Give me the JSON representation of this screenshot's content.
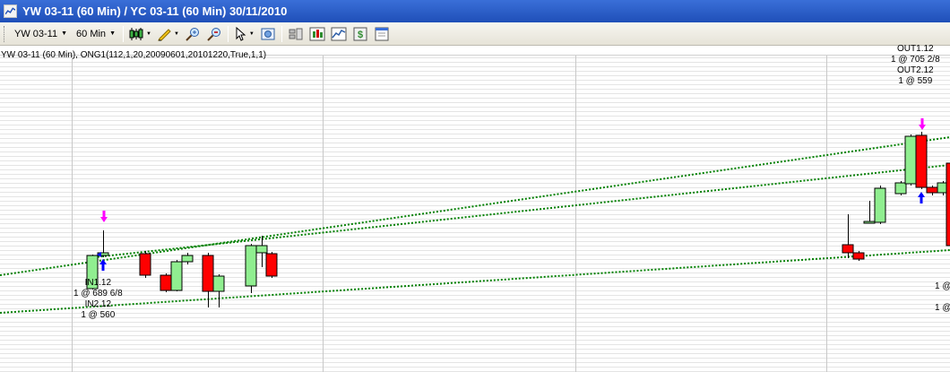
{
  "window": {
    "title": "YW 03-11 (60 Min) / YC 03-11 (60 Min)  30/11/2010"
  },
  "toolbar": {
    "symbol_value": "YW 03-11",
    "interval_value": "60 Min",
    "buttons": [
      "bar-type-icon",
      "drawing-pencil-icon",
      "zoom-in-icon",
      "zoom-out-icon",
      "cursor-select-icon",
      "chart-properties-icon",
      "data-box-icon",
      "indicators-icon",
      "chart-style-icon",
      "strategies-icon",
      "window-template-icon"
    ]
  },
  "chart": {
    "study_label": "YW 03-11 (60 Min), ONG1(112,1,20,20090601,20101220,True,1,1)",
    "entry_labels": [
      "IN1.12",
      "1 @ 689 6/8",
      "IN2.12",
      "1 @ 560"
    ],
    "exit_labels": [
      "OUT1.12",
      "1 @ 705 2/8",
      "OUT2.12",
      "1 @ 559"
    ],
    "right_edge_labels": [
      "1 @",
      "1 @"
    ],
    "colors": {
      "up_candle": "#90ee90",
      "down_candle": "#ff0000",
      "trend_line": "#008000",
      "entry_arrow": "#0000ff",
      "exit_arrow": "#ff00ff",
      "grid": "#c8c8c8"
    }
  }
}
